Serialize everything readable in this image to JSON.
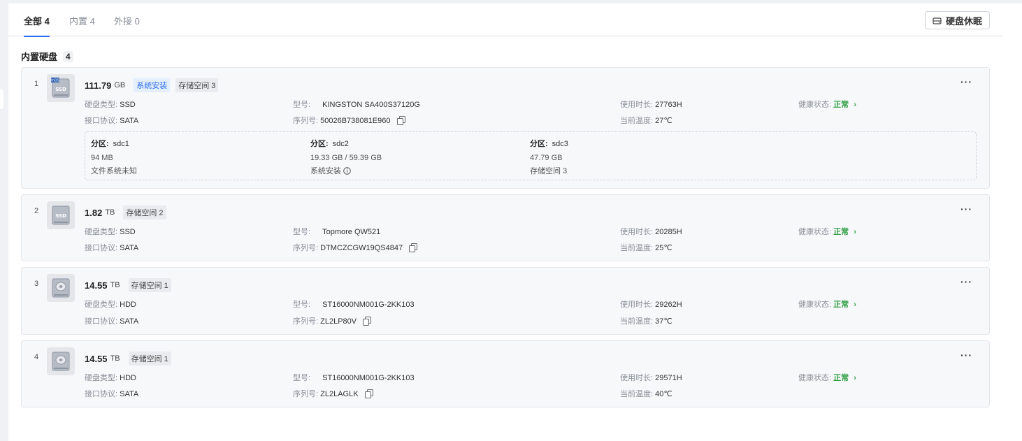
{
  "tabs": [
    {
      "label": "全部 4"
    },
    {
      "label": "内置 4"
    },
    {
      "label": "外接 0"
    }
  ],
  "sleep_button": {
    "label": "硬盘休眠",
    "icon": "disk-sleep-icon"
  },
  "section": {
    "title": "内置硬盘",
    "count": "4"
  },
  "labels": {
    "type": "硬盘类型:",
    "protocol": "接口协议:",
    "model": "型号:",
    "serial": "序列号:",
    "hours": "使用时长:",
    "temp": "当前温度:",
    "health": "健康状态:",
    "partition": "分区:"
  },
  "disks": [
    {
      "index": "1",
      "capacity": "111.79",
      "unit": "GB",
      "tags": [
        "系统安装",
        "存储空间 3"
      ],
      "type": "SSD",
      "protocol": "SATA",
      "model": "KINGSTON SA400S37120G",
      "serial": "50026B738081E960",
      "hours": "27763H",
      "temp": "27℃",
      "health": "正常",
      "icon": "ssd-system-icon",
      "partitions": [
        {
          "name": "sdc1",
          "size": "94 MB",
          "desc": "文件系统未知"
        },
        {
          "name": "sdc2",
          "size": "19.33 GB / 59.39 GB",
          "desc": "系统安装"
        },
        {
          "name": "sdc3",
          "size": "47.79 GB",
          "desc": "存储空间 3"
        }
      ]
    },
    {
      "index": "2",
      "capacity": "1.82",
      "unit": "TB",
      "tags": [
        "存储空间 2"
      ],
      "type": "SSD",
      "protocol": "SATA",
      "model": "Topmore QW521",
      "serial": "DTMCZCGW19QS4847",
      "hours": "20285H",
      "temp": "25℃",
      "health": "正常",
      "icon": "ssd-icon"
    },
    {
      "index": "3",
      "capacity": "14.55",
      "unit": "TB",
      "tags": [
        "存储空间 1"
      ],
      "type": "HDD",
      "protocol": "SATA",
      "model": "ST16000NM001G-2KK103",
      "serial": "ZL2LP80V",
      "hours": "29262H",
      "temp": "37℃",
      "health": "正常",
      "icon": "hdd-icon"
    },
    {
      "index": "4",
      "capacity": "14.55",
      "unit": "TB",
      "tags": [
        "存储空间 1"
      ],
      "type": "HDD",
      "protocol": "SATA",
      "model": "ST16000NM001G-2KK103",
      "serial": "ZL2LAGLK",
      "hours": "29571H",
      "temp": "40℃",
      "health": "正常",
      "icon": "hdd-icon"
    }
  ],
  "colors": {
    "accent": "#2f6fed",
    "healthy": "#2f9e44"
  }
}
